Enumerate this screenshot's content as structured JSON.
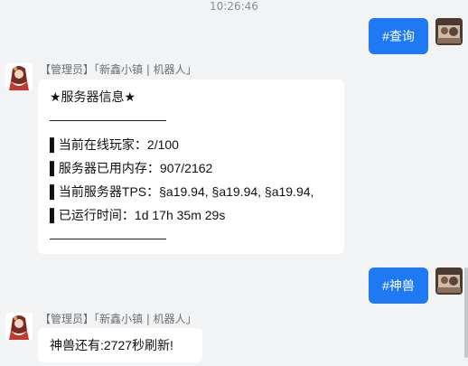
{
  "chat": {
    "timestamp": "10:26:46",
    "messages": [
      {
        "text": "#查询"
      },
      {
        "sender": "【管理员】「新鑫小镇 | 机器人」",
        "lines": [
          "★服务器信息★",
          "▌当前在线玩家：2/100",
          "▌服务器已用内存：907/2162",
          "▌当前服务器TPS：§a19.94, §a19.94, §a19.94,",
          "▌已运行时间：1d 17h 35m 29s"
        ]
      },
      {
        "text": "#神兽"
      },
      {
        "sender": "【管理员】「新鑫小镇 | 机器人」",
        "text": "神兽还有:2727秒刷新!"
      }
    ]
  }
}
